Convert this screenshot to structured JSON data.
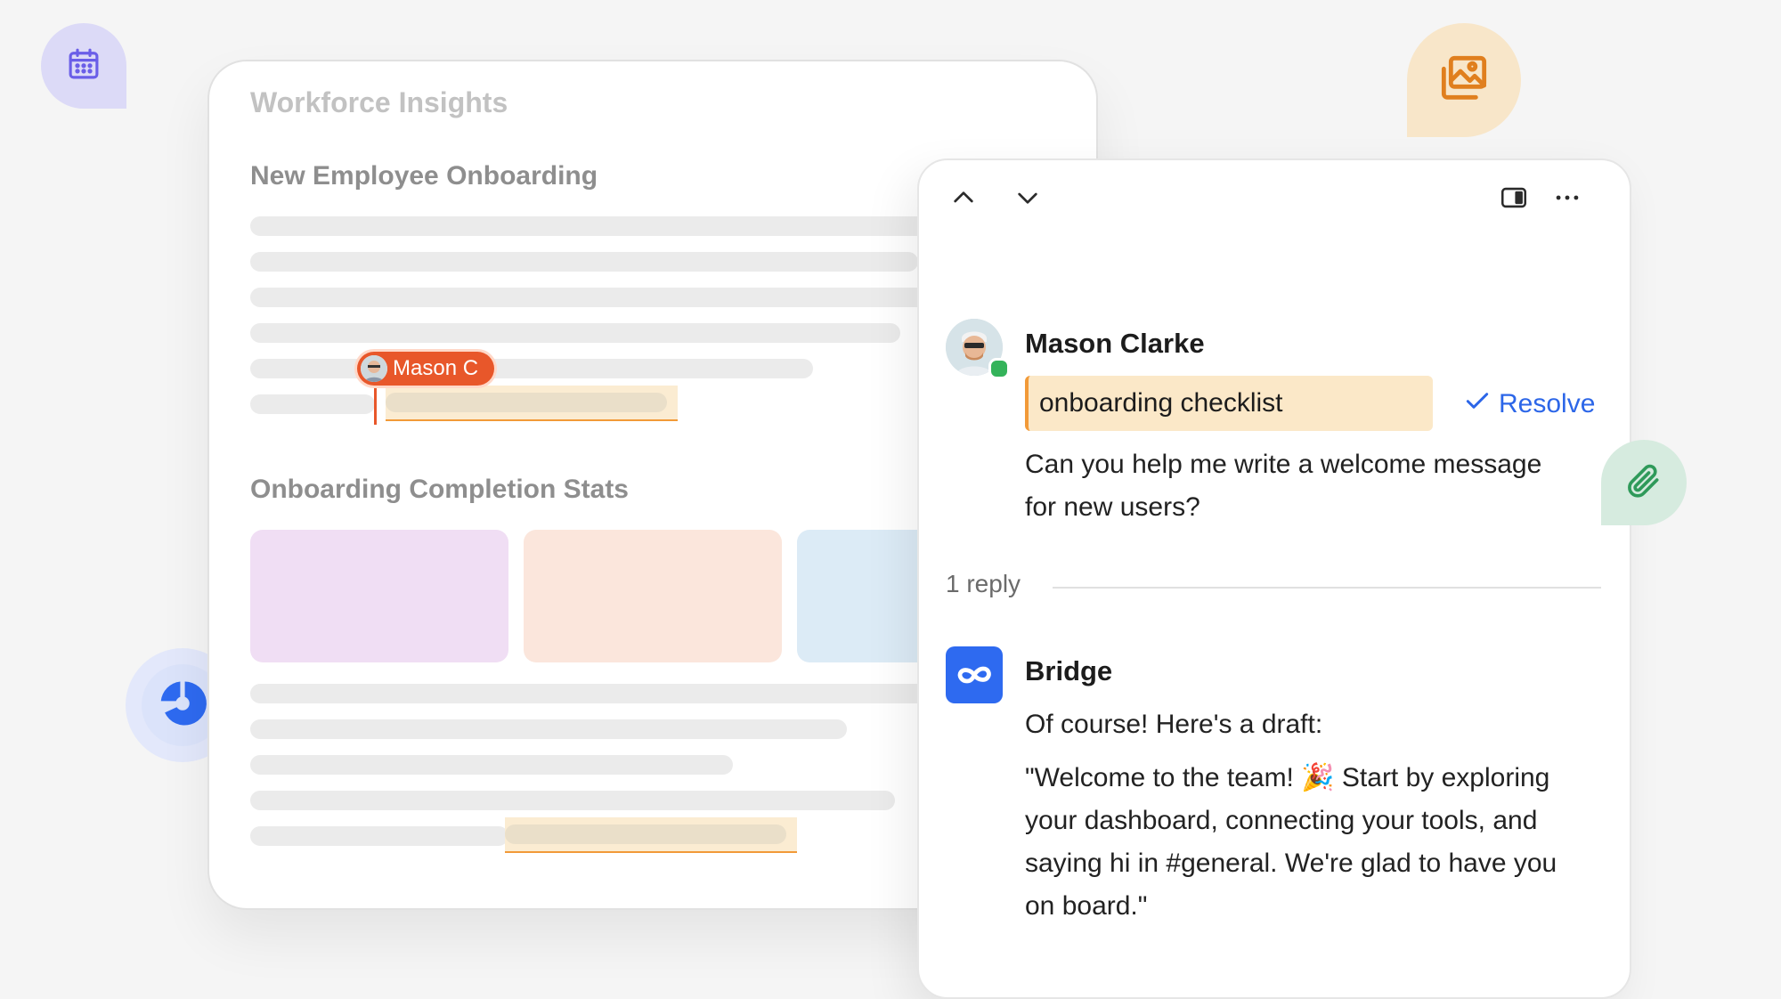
{
  "colors": {
    "accent_blue": "#2c66e8",
    "mention_orange": "#e8572a",
    "highlight": "#fbe8c8",
    "online_green": "#34b35a"
  },
  "floating_icons": [
    "calendar-icon",
    "image-gallery-icon",
    "paperclip-icon",
    "pie-chart-icon"
  ],
  "document": {
    "title": "Workforce Insights",
    "section1_heading": "New Employee Onboarding",
    "mention_label": "Mason C",
    "section2_heading": "Onboarding Completion Stats"
  },
  "panel": {
    "toolbar_icons": [
      "chevron-up-icon",
      "chevron-down-icon",
      "sidebar-toggle-icon",
      "more-icon"
    ],
    "comment": {
      "author": "Mason Clarke",
      "quoted_text": "onboarding checklist",
      "resolve_label": "Resolve",
      "message_line1": "Can you help me write a welcome message",
      "message_line2": "for new users?"
    },
    "reply_count": "1 reply",
    "reply": {
      "author": "Bridge",
      "intro": "Of course! Here's a draft:",
      "draft_line1": "\"Welcome to the team! 🎉 Start by exploring",
      "draft_line2": "your dashboard, connecting your tools, and",
      "draft_line3": "saying hi in #general. We're glad to have you",
      "draft_line4": "on board.\""
    }
  }
}
